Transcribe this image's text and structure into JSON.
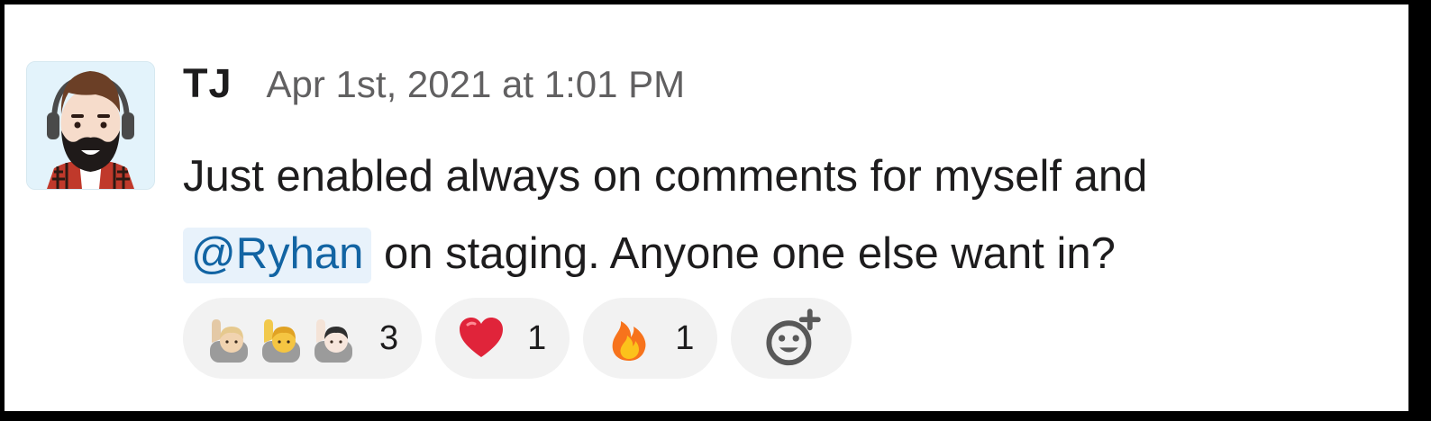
{
  "message": {
    "author": "TJ",
    "timestamp": "Apr 1st, 2021 at 1:01 PM",
    "text_before_mention": "Just enabled always on comments for myself and",
    "mention": "@Ryhan",
    "text_after_mention": "on staging. Anyone one else want in?"
  },
  "reactions": [
    {
      "icons": [
        "raising-hand-blond-icon",
        "raising-hand-light-icon",
        "raising-hand-white-icon"
      ],
      "count": "3"
    },
    {
      "icons": [
        "red-heart-icon"
      ],
      "count": "1"
    },
    {
      "icons": [
        "fire-icon"
      ],
      "count": "1"
    }
  ],
  "add_reaction_icon": "add-reaction-icon",
  "colors": {
    "mention_bg": "#e8f2fb",
    "mention_text": "#1264a3",
    "reaction_bg": "#f2f2f2",
    "heart": "#e0243a",
    "fire": "#f7731c"
  }
}
